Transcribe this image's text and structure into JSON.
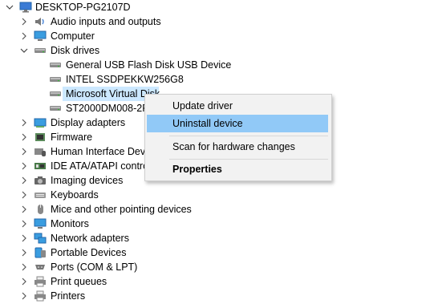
{
  "root": {
    "label": "DESKTOP-PG2107D",
    "icon": "computer-icon"
  },
  "categories": [
    {
      "label": "Audio inputs and outputs",
      "icon": "speaker-icon",
      "expanded": false
    },
    {
      "label": "Computer",
      "icon": "monitor-icon",
      "expanded": false
    },
    {
      "label": "Disk drives",
      "icon": "disk-drive-icon",
      "expanded": true
    },
    {
      "label": "Display adapters",
      "icon": "display-adapter-icon",
      "expanded": false
    },
    {
      "label": "Firmware",
      "icon": "firmware-icon",
      "expanded": false
    },
    {
      "label": "Human Interface Devi",
      "icon": "hid-icon",
      "expanded": false
    },
    {
      "label": "IDE ATA/ATAPI control",
      "icon": "ide-controller-icon",
      "expanded": false
    },
    {
      "label": "Imaging devices",
      "icon": "camera-icon",
      "expanded": false
    },
    {
      "label": "Keyboards",
      "icon": "keyboard-icon",
      "expanded": false
    },
    {
      "label": "Mice and other pointing devices",
      "icon": "mouse-icon",
      "expanded": false
    },
    {
      "label": "Monitors",
      "icon": "monitor-icon",
      "expanded": false
    },
    {
      "label": "Network adapters",
      "icon": "network-icon",
      "expanded": false
    },
    {
      "label": "Portable Devices",
      "icon": "portable-device-icon",
      "expanded": false
    },
    {
      "label": "Ports (COM & LPT)",
      "icon": "port-icon",
      "expanded": false
    },
    {
      "label": "Print queues",
      "icon": "printer-icon",
      "expanded": false
    },
    {
      "label": "Printers",
      "icon": "printer-icon",
      "expanded": false
    }
  ],
  "disk_drives": [
    {
      "label": "General USB Flash Disk USB Device"
    },
    {
      "label": "INTEL SSDPEKKW256G8"
    },
    {
      "label": "Microsoft Virtual Disk",
      "selected": true
    },
    {
      "label": "ST2000DM008-2FR"
    }
  ],
  "context_menu": {
    "items": [
      {
        "label": "Update driver"
      },
      {
        "label": "Uninstall device",
        "highlighted": true
      },
      {
        "label": "Scan for hardware changes"
      },
      {
        "label": "Properties",
        "bold": true
      }
    ]
  },
  "colors": {
    "selection": "#cce8ff",
    "menu_highlight": "#91c9f7",
    "menu_background": "#f2f2f2"
  }
}
